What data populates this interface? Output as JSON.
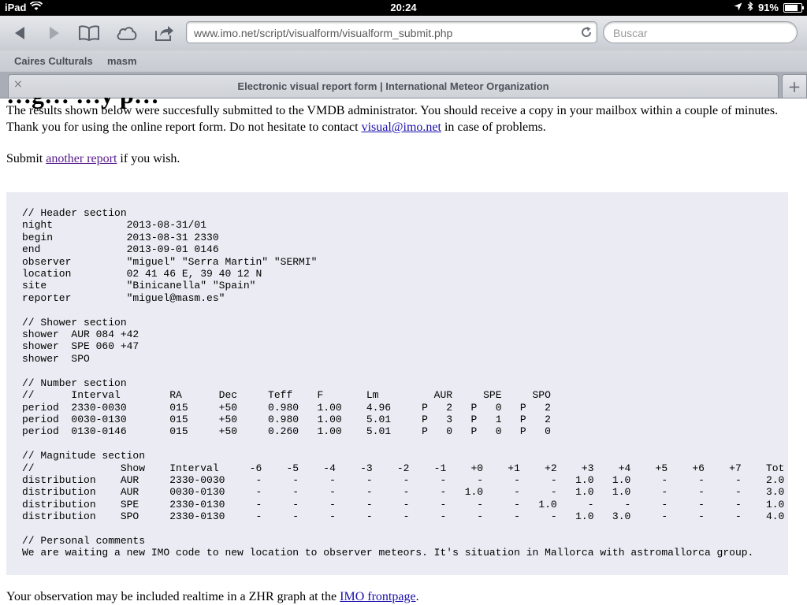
{
  "status_bar": {
    "device": "iPad",
    "time": "20:24",
    "battery": "91%",
    "battery_level": 0.91
  },
  "toolbar": {
    "url": "www.imo.net/script/visualform/visualform_submit.php",
    "search_placeholder": "Buscar"
  },
  "bookmarks": [
    "Caires Culturals",
    "masm"
  ],
  "tab": {
    "title": "Electronic visual report form | International Meteor Organization",
    "close": "×",
    "add": "+"
  },
  "page": {
    "partial_heading": "…g… …y p…",
    "intro_text": "The results shown below were succesfully submitted to the VMDB administrator. You should receive a copy in your mailbox within a couple of minutes. Thank you for using the online report form. Do not hesitate to contact ",
    "contact_link": "visual@imo.net",
    "intro_suffix": " in case of problems.",
    "submit_prefix": "Submit ",
    "another_report_link": "another report",
    "submit_suffix": " if you wish.",
    "report_text": "// Header section\nnight            2013-08-31/01\nbegin            2013-08-31 2330\nend              2013-09-01 0146\nobserver         \"miguel\" \"Serra Martin\" \"SERMI\"\nlocation         02 41 46 E, 39 40 12 N\nsite             \"Binicanella\" \"Spain\"\nreporter         \"miguel@masm.es\"\n\n// Shower section\nshower  AUR 084 +42\nshower  SPE 060 +47\nshower  SPO\n\n// Number section\n//      Interval        RA      Dec     Teff    F       Lm         AUR     SPE     SPO\nperiod  2330-0030       015     +50     0.980   1.00    4.96     P   2   P   0   P   2\nperiod  0030-0130       015     +50     0.980   1.00    5.01     P   3   P   1   P   2\nperiod  0130-0146       015     +50     0.260   1.00    5.01     P   0   P   0   P   0\n\n// Magnitude section\n//              Show    Interval     -6    -5    -4    -3    -2    -1    +0    +1    +2    +3    +4    +5    +6    +7    Tot\ndistribution    AUR     2330-0030     -     -     -     -     -     -     -     -     -   1.0   1.0     -     -     -    2.0\ndistribution    AUR     0030-0130     -     -     -     -     -     -   1.0     -     -   1.0   1.0     -     -     -    3.0\ndistribution    SPE     2330-0130     -     -     -     -     -     -     -     -   1.0     -     -     -     -     -    1.0\ndistribution    SPO     2330-0130     -     -     -     -     -     -     -     -     -   1.0   3.0     -     -     -    4.0\n\n// Personal comments\nWe are waiting a new IMO code to new location to observer meteors. It's situation in Mallorca with astromallorca group.",
    "footer_prefix": "Your observation may be included realtime in a ZHR graph at the ",
    "footer_link": "IMO frontpage",
    "footer_suffix": "."
  }
}
